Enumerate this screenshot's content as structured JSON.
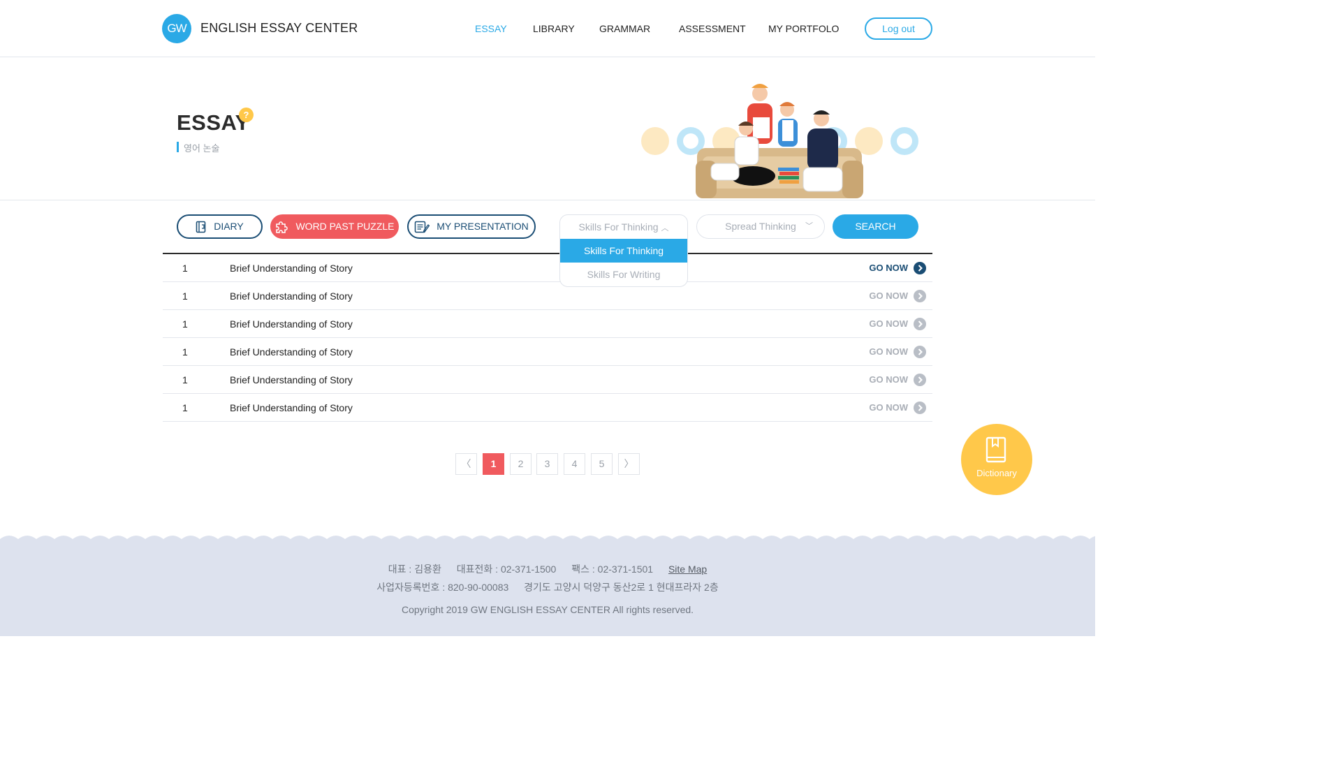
{
  "header": {
    "logo_text": "GW",
    "brand": "ENGLISH ESSAY CENTER",
    "nav": [
      {
        "label": "ESSAY",
        "active": true
      },
      {
        "label": "LIBRARY",
        "active": false
      },
      {
        "label": "GRAMMAR",
        "active": false
      },
      {
        "label": "ASSESSMENT",
        "active": false
      },
      {
        "label": "MY PORTFOLO",
        "active": false
      }
    ],
    "logout_label": "Log out"
  },
  "hero": {
    "title": "ESSAY",
    "help_badge": "?",
    "subtitle": "영어 논술"
  },
  "tools": {
    "buttons": [
      {
        "label": "DIARY",
        "icon": "diary-icon"
      },
      {
        "label": "WORD PAST PUZZLE",
        "icon": "puzzle-icon"
      },
      {
        "label": "MY PRESENTATION",
        "icon": "presentation-icon"
      }
    ],
    "select1": {
      "value": "Skills For Thinking",
      "options": [
        "Skills For Thinking",
        "Skills For Writing"
      ],
      "selected_index": 0,
      "open": true
    },
    "select2": {
      "value": "Spread Thinking"
    },
    "search_label": "SEARCH"
  },
  "list": {
    "go_label": "GO NOW",
    "rows": [
      {
        "num": "1",
        "title": "Brief Understanding of Story"
      },
      {
        "num": "1",
        "title": "Brief Understanding of Story"
      },
      {
        "num": "1",
        "title": "Brief Understanding of Story"
      },
      {
        "num": "1",
        "title": "Brief Understanding of Story"
      },
      {
        "num": "1",
        "title": "Brief Understanding of Story"
      },
      {
        "num": "1",
        "title": "Brief Understanding of Story"
      }
    ]
  },
  "pagination": {
    "prev": "〈",
    "next": "〉",
    "pages": [
      "1",
      "2",
      "3",
      "4",
      "5"
    ],
    "current": "1"
  },
  "dictionary": {
    "label": "Dictionary"
  },
  "footer": {
    "ceo": "대표 : 김용환",
    "phone": "대표전화 : 02-371-1500",
    "fax": "팩스 : 02-371-1501",
    "sitemap": "Site Map",
    "biz_no": "사업자등록번호 : 820-90-00083",
    "address": "경기도 고양시 덕양구 동산2로 1 현대프라자 2층",
    "copyright": "Copyright 2019 GW ENGLISH ESSAY CENTER All rights reserved."
  },
  "colors": {
    "accent": "#2aa9e6",
    "navy": "#1a4d74",
    "red": "#f05a5e",
    "yellow": "#ffc84a",
    "footer_bg": "#dde2ee"
  }
}
